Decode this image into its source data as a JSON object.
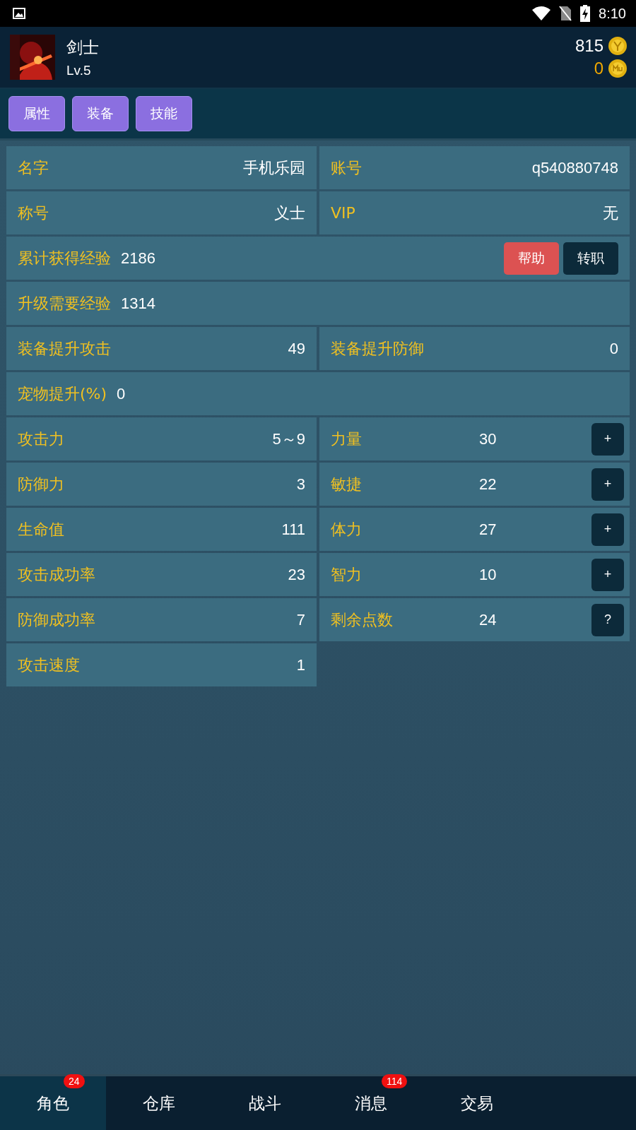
{
  "status_bar": {
    "time": "8:10"
  },
  "profile": {
    "name": "剑士",
    "level": "Lv.5",
    "gold": "815",
    "mu": "0"
  },
  "tabs": [
    {
      "label": "属性"
    },
    {
      "label": "装备"
    },
    {
      "label": "技能"
    }
  ],
  "rows": [
    {
      "cells": [
        {
          "kind": "pair",
          "label": "名字",
          "value": "手机乐园"
        },
        {
          "kind": "pair",
          "label": "账号",
          "value": "q540880748"
        }
      ]
    },
    {
      "cells": [
        {
          "kind": "pair",
          "label": "称号",
          "value": "义士"
        },
        {
          "kind": "pair",
          "label": "VIP",
          "value": "无"
        }
      ]
    },
    {
      "cells": [
        {
          "kind": "inline",
          "label": "累计获得经验",
          "value": "2186",
          "buttons": [
            {
              "label": "帮助",
              "kind": "danger"
            },
            {
              "label": "转职",
              "kind": "dark"
            }
          ]
        }
      ]
    },
    {
      "cells": [
        {
          "kind": "inline",
          "label": "升级需要经验",
          "value": "1314"
        }
      ]
    },
    {
      "cells": [
        {
          "kind": "pair",
          "label": "装备提升攻击",
          "value": "49"
        },
        {
          "kind": "pair",
          "label": "装备提升防御",
          "value": "0"
        }
      ]
    },
    {
      "cells": [
        {
          "kind": "inline",
          "label": "宠物提升(%)",
          "value": "0"
        }
      ]
    },
    {
      "cells": [
        {
          "kind": "pair",
          "label": "攻击力",
          "value": "5～9"
        },
        {
          "kind": "stat",
          "label": "力量",
          "value": "30",
          "button": "+"
        }
      ]
    },
    {
      "cells": [
        {
          "kind": "pair",
          "label": "防御力",
          "value": "3"
        },
        {
          "kind": "stat",
          "label": "敏捷",
          "value": "22",
          "button": "+"
        }
      ]
    },
    {
      "cells": [
        {
          "kind": "pair",
          "label": "生命值",
          "value": "111"
        },
        {
          "kind": "stat",
          "label": "体力",
          "value": "27",
          "button": "+"
        }
      ]
    },
    {
      "cells": [
        {
          "kind": "pair",
          "label": "攻击成功率",
          "value": "23"
        },
        {
          "kind": "stat",
          "label": "智力",
          "value": "10",
          "button": "+"
        }
      ]
    },
    {
      "cells": [
        {
          "kind": "pair",
          "label": "防御成功率",
          "value": "7"
        },
        {
          "kind": "stat",
          "label": "剩余点数",
          "value": "24",
          "button": "?"
        }
      ]
    },
    {
      "cells": [
        {
          "kind": "pair",
          "label": "攻击速度",
          "value": "1"
        }
      ]
    }
  ],
  "bottom_nav": [
    {
      "label": "角色",
      "selected": true,
      "badge": "24"
    },
    {
      "label": "仓库",
      "selected": false
    },
    {
      "label": "战斗",
      "selected": false
    },
    {
      "label": "消息",
      "selected": false,
      "badge": "114"
    },
    {
      "label": "交易",
      "selected": false
    }
  ]
}
